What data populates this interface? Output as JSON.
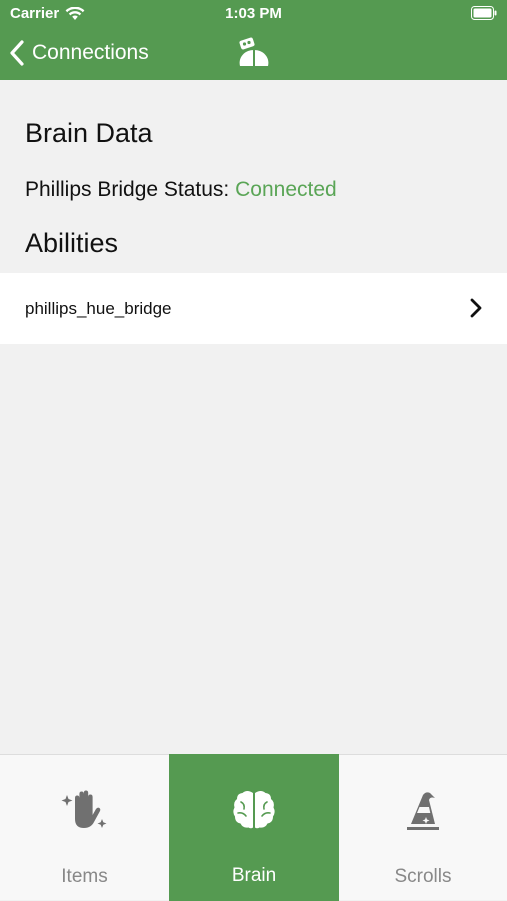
{
  "status_bar": {
    "carrier": "Carrier",
    "time": "1:03 PM",
    "icons": [
      "wifi-icon",
      "battery-icon"
    ]
  },
  "nav": {
    "back_label": "Connections",
    "logo_icon": "robot-logo-icon"
  },
  "content": {
    "brain_title": "Brain Data",
    "bridge_status_label": "Phillips Bridge Status:",
    "bridge_status_value": "Connected",
    "abilities_title": "Abilities",
    "abilities": [
      {
        "label": "phillips_hue_bridge",
        "icon": "chevron-right-icon"
      }
    ]
  },
  "tabs": [
    {
      "label": "Items",
      "icon": "magic-hand-icon",
      "selected": false
    },
    {
      "label": "Brain",
      "icon": "brain-icon",
      "selected": true
    },
    {
      "label": "Scrolls",
      "icon": "wizard-hat-icon",
      "selected": false
    }
  ],
  "colors": {
    "accent": "#559a51",
    "status_connected": "#5aa556",
    "background": "#f1f1f1",
    "tab_inactive": "#888888"
  }
}
